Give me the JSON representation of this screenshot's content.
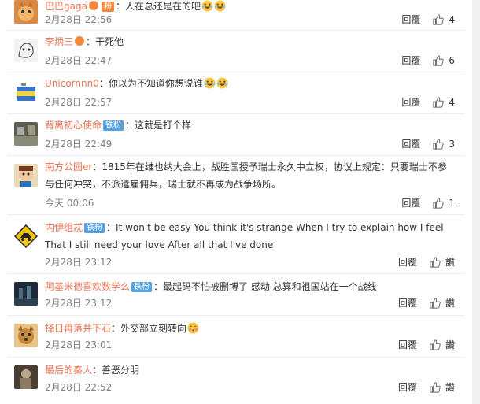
{
  "comments": [
    {
      "user": "巴巴gaga",
      "badge": "",
      "text": "人在总还是在的吧",
      "emojis": 2,
      "time": "2月28日 22:56",
      "reply": "回覆",
      "likes": "4",
      "avatar": "cat",
      "color": "#c97b3d"
    },
    {
      "user": "李炳三",
      "badge": "",
      "text": "干死他",
      "emojis": 0,
      "time": "2月28日 22:47",
      "reply": "回覆",
      "likes": "6",
      "avatar": "sketch",
      "color": "#e6e6e6"
    },
    {
      "user": "Unicornnn0",
      "badge": "",
      "text": "你以为不知道你想说谁",
      "emojis": 2,
      "time": "2月28日 22:57",
      "reply": "回覆",
      "likes": "4",
      "avatar": "flag",
      "color": "#3b74c7"
    },
    {
      "user": "背离初心使命",
      "badge": "铁粉",
      "text": "这就是打个样",
      "emojis": 0,
      "time": "2月28日 22:49",
      "reply": "回覆",
      "likes": "3",
      "avatar": "dark",
      "color": "#6a6a5a"
    },
    {
      "user": "南方公园er",
      "badge": "",
      "text": "1815年在维也纳大会上，战胜国授予瑞士永久中立权，协议上规定：只要瑞士不参与任何冲突，不派遣雇佣兵，瑞士就不再成为战争场所。",
      "emojis": 0,
      "time": "今天 00:06",
      "reply": "回覆",
      "likes": "1",
      "avatar": "cartoon",
      "color": "#9a7a55"
    },
    {
      "user": "内伊组忒",
      "badge": "铁粉",
      "text": "It won't be easy You think it's strange When I try to explain how I feel That I still need your love After all that I've done",
      "emojis": 0,
      "time": "2月28日 23:12",
      "reply": "回覆",
      "likes": "讚",
      "avatar": "sign",
      "color": "#f1c40f"
    },
    {
      "user": "阿基米德喜欢数学么",
      "badge": "铁粉",
      "text": "最起码不怕被删博了 感动 总算和祖国站在一个战线",
      "emojis": 0,
      "time": "2月28日 23:12",
      "reply": "回覆",
      "likes": "讚",
      "avatar": "night",
      "color": "#3a4a5e"
    },
    {
      "user": "择日再落井下石",
      "badge": "",
      "text": "外交部立刻转向",
      "emojis": 1,
      "time": "2月28日 23:01",
      "reply": "回覆",
      "likes": "讚",
      "avatar": "dog",
      "color": "#c8893a"
    },
    {
      "user": "最后的秦人",
      "badge": "",
      "text": "善恶分明",
      "emojis": 0,
      "time": "2月28日 22:52",
      "reply": "回覆",
      "likes": "讚",
      "avatar": "statue",
      "color": "#7a6a55"
    }
  ]
}
